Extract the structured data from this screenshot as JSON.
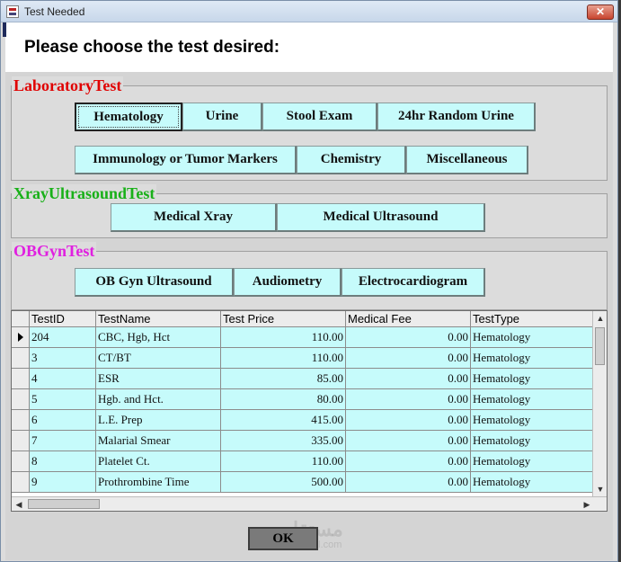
{
  "window": {
    "title": "Test Needed",
    "close_label": "✕"
  },
  "heading": "Please choose the test desired:",
  "groups": {
    "laboratory": {
      "label": "LaboratoryTest",
      "color": "#e00000",
      "buttons": [
        "Hematology",
        "Urine",
        "Stool Exam",
        "24hr Random Urine",
        "Immunology or Tumor Markers",
        "Chemistry",
        "Miscellaneous"
      ]
    },
    "xray": {
      "label": "XrayUltrasoundTest",
      "color": "#18b018",
      "buttons": [
        "Medical Xray",
        "Medical Ultrasound"
      ]
    },
    "obgyn": {
      "label": "OBGynTest",
      "color": "#e020e0",
      "buttons": [
        "OB Gyn Ultrasound",
        "Audiometry",
        "Electrocardiogram"
      ]
    }
  },
  "grid": {
    "columns": [
      "TestID",
      "TestName",
      "Test Price",
      "Medical Fee",
      "TestType"
    ],
    "rows": [
      [
        "204",
        "CBC, Hgb, Hct",
        "110.00",
        "0.00",
        "Hematology"
      ],
      [
        "3",
        "CT/BT",
        "110.00",
        "0.00",
        "Hematology"
      ],
      [
        "4",
        "ESR",
        "85.00",
        "0.00",
        "Hematology"
      ],
      [
        "5",
        "Hgb. and Hct.",
        "80.00",
        "0.00",
        "Hematology"
      ],
      [
        "6",
        "L.E. Prep",
        "415.00",
        "0.00",
        "Hematology"
      ],
      [
        "7",
        "Malarial Smear",
        "335.00",
        "0.00",
        "Hematology"
      ],
      [
        "8",
        "Platelet Ct.",
        "110.00",
        "0.00",
        "Hematology"
      ],
      [
        "9",
        "Prothrombine Time",
        "500.00",
        "0.00",
        "Hematology"
      ]
    ]
  },
  "ok_label": "OK",
  "watermark": {
    "text": "مستقل",
    "sub": "mostaql.com"
  }
}
